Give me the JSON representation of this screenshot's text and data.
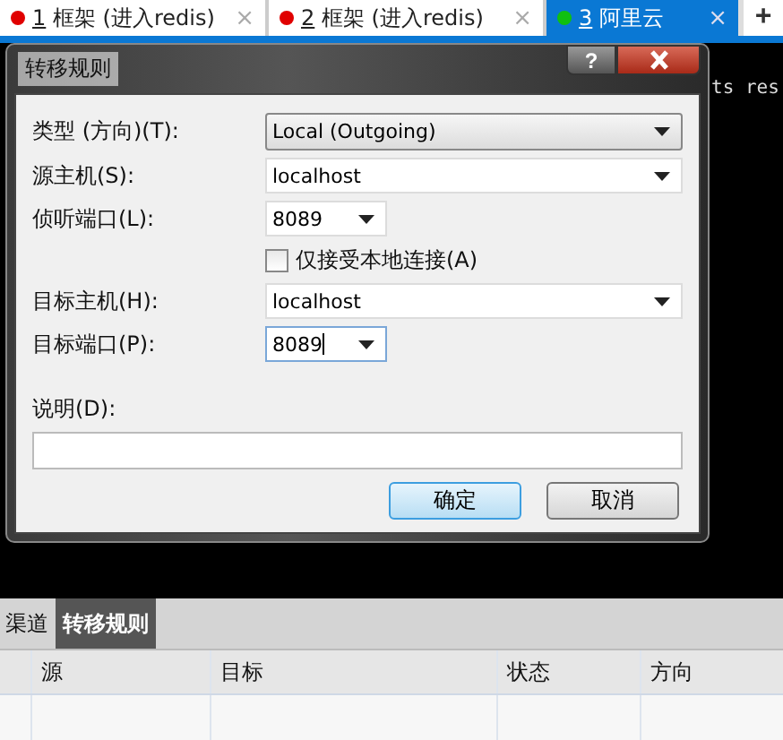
{
  "tabs": [
    {
      "number": "1",
      "label": "框架 (进入redis)",
      "color": "#e00000",
      "close": "×",
      "selected": false
    },
    {
      "number": "2",
      "label": "框架 (进入redis)",
      "color": "#e00000",
      "close": "×",
      "selected": false
    },
    {
      "number": "3",
      "label": "阿里云",
      "color": "#10c010",
      "close": "×",
      "selected": true
    }
  ],
  "new_tab": "+",
  "terminal_text": "ts res",
  "dialog": {
    "title": "转移规则",
    "help": "?",
    "fields": [
      {
        "kind": "select",
        "label": "类型 (方向)(T):",
        "value": "Local (Outgoing)"
      },
      {
        "kind": "combo",
        "label": "源主机(S):",
        "value": "localhost",
        "focused": false
      },
      {
        "kind": "port",
        "label": "侦听端口(L):",
        "value": "8089",
        "focused": false
      },
      {
        "kind": "checkbox",
        "label": "仅接受本地连接(A)",
        "checked": false
      },
      {
        "kind": "combo",
        "label": "目标主机(H):",
        "value": "localhost",
        "focused": false
      },
      {
        "kind": "port",
        "label": "目标端口(P):",
        "value": "8089",
        "focused": true
      }
    ],
    "description": {
      "label": "说明(D):"
    },
    "buttons": [
      {
        "label": "确定",
        "default": true
      },
      {
        "label": "取消",
        "default": false
      }
    ]
  },
  "panel_tabs": [
    {
      "label": "渠道",
      "selected": false
    },
    {
      "label": "转移规则",
      "selected": true
    }
  ],
  "table": {
    "columns": [
      "源",
      "目标",
      "状态",
      "方向"
    ]
  }
}
